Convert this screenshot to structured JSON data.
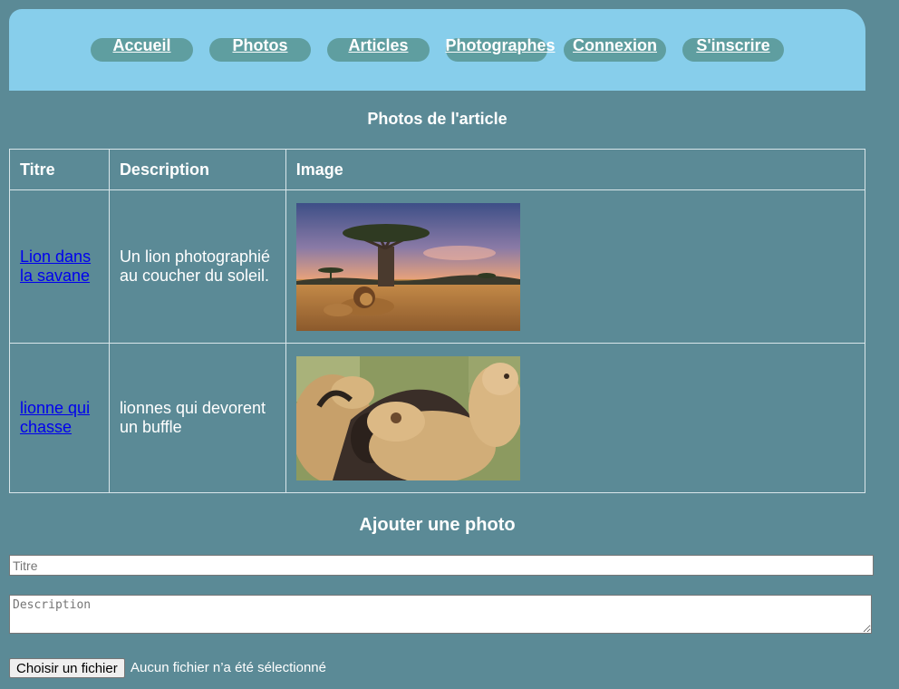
{
  "nav": {
    "items": [
      {
        "label": "Accueil"
      },
      {
        "label": "Photos"
      },
      {
        "label": "Articles"
      },
      {
        "label": "Photographes"
      },
      {
        "label": "Connexion"
      },
      {
        "label": "S'inscrire"
      }
    ]
  },
  "table_section": {
    "title": "Photos de l'article",
    "headers": [
      "Titre",
      "Description",
      "Image"
    ],
    "rows": [
      {
        "title": "Lion dans la savane",
        "description": "Un lion photographié au coucher du soleil.",
        "image_icon": "lion-savanna-photo"
      },
      {
        "title": "lionne qui chasse",
        "description": "lionnes qui devorent un buffle",
        "image_icon": "lionesses-hunting-photo"
      }
    ]
  },
  "form": {
    "title": "Ajouter une photo",
    "title_placeholder": "Titre",
    "description_placeholder": "Description",
    "file_button_label": "Choisir un fichier",
    "file_status": "Aucun fichier n’a été sélectionné"
  },
  "colors": {
    "page_background": "#5b8a96",
    "nav_background": "#87ceeb",
    "nav_pill": "#5f9ea0",
    "link": "#0000ee"
  }
}
